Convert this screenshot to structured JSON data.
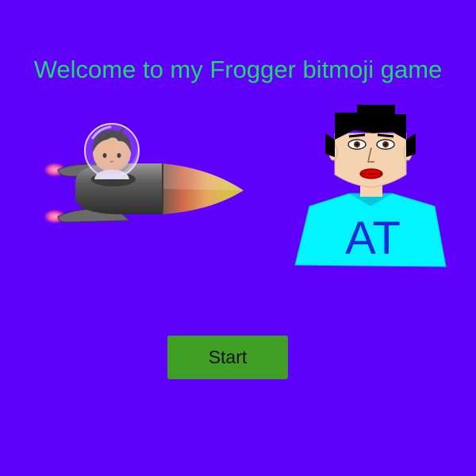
{
  "title": "Welcome to my Frogger bitmoji game",
  "start_button": {
    "label": "Start"
  },
  "player_badge": {
    "initials": "AT"
  },
  "colors": {
    "background": "#5f00fb",
    "title": "#22d86e",
    "button": "#3f9f24",
    "shirt": "#00f5ff",
    "initials": "#1a2bd6"
  },
  "icons": {
    "rocket": "astronaut-rocket-icon",
    "player": "bitmoji-player-icon"
  }
}
